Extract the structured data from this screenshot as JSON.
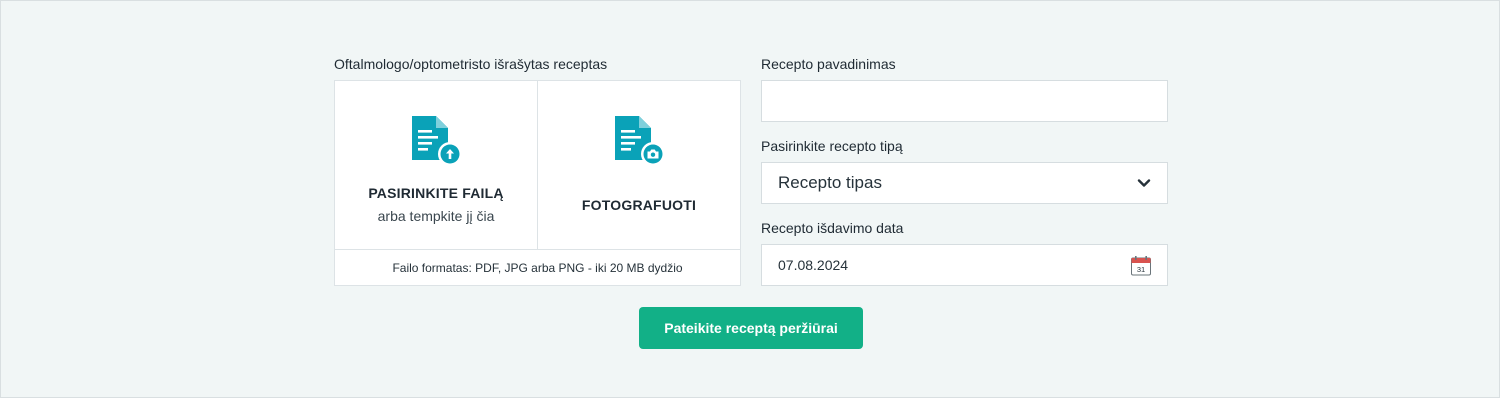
{
  "upload": {
    "section_label": "Oftalmologo/optometristo išrašytas receptas",
    "file_option": {
      "title": "PASIRINKITE FAILĄ",
      "subtitle": "arba tempkite jį čia",
      "icon": "document-upload-icon"
    },
    "photo_option": {
      "title": "FOTOGRAFUOTI",
      "icon": "document-camera-icon"
    },
    "format_note": "Failo formatas: PDF, JPG arba PNG - iki 20 MB dydžio"
  },
  "form": {
    "name_label": "Recepto pavadinimas",
    "name_value": "",
    "type_label": "Pasirinkite recepto tipą",
    "type_value": "Recepto tipas",
    "date_label": "Recepto išdavimo data",
    "date_value": "07.08.2024",
    "calendar_day": "31"
  },
  "submit_label": "Pateikite receptą peržiūrai",
  "colors": {
    "accent": "#12b087",
    "icon": "#0aa2b8",
    "background": "#f1f6f6"
  }
}
